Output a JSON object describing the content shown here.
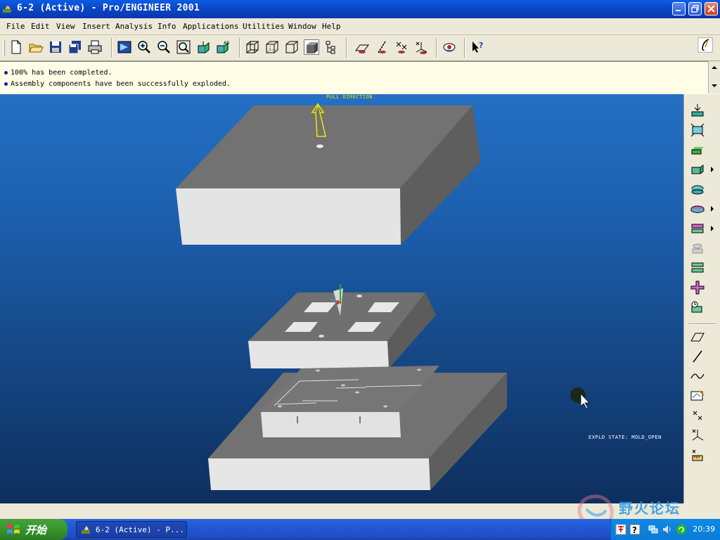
{
  "window": {
    "title": "6-2 (Active) - Pro/ENGINEER 2001"
  },
  "menu": [
    {
      "label": "File"
    },
    {
      "label": "Edit"
    },
    {
      "label": "View"
    },
    {
      "label": "Insert"
    },
    {
      "label": "Analysis"
    },
    {
      "label": "Info"
    },
    {
      "label": "Applications"
    },
    {
      "label": "Utilities"
    },
    {
      "label": "Window"
    },
    {
      "label": "Help"
    }
  ],
  "messages": [
    "100% has been completed.",
    "Assembly components have been successfully exploded."
  ],
  "viewport": {
    "pull_direction_label": "PULL DIRECTION",
    "explode_state_label": "EXPLD STATE: MOLD_OPEN"
  },
  "taskbar": {
    "start_label": "开始",
    "task_item_label": "6-2 (Active) - P...",
    "clock": "20:39",
    "watermark": "野火论坛"
  },
  "colors": {
    "titlebar": "#0c48c8",
    "viewport_top": "#2470c4",
    "viewport_bottom": "#0e2f5e",
    "pull_arrow": "#e6e600",
    "mold_top": "#707070",
    "mold_front": "#e6e6e6"
  }
}
